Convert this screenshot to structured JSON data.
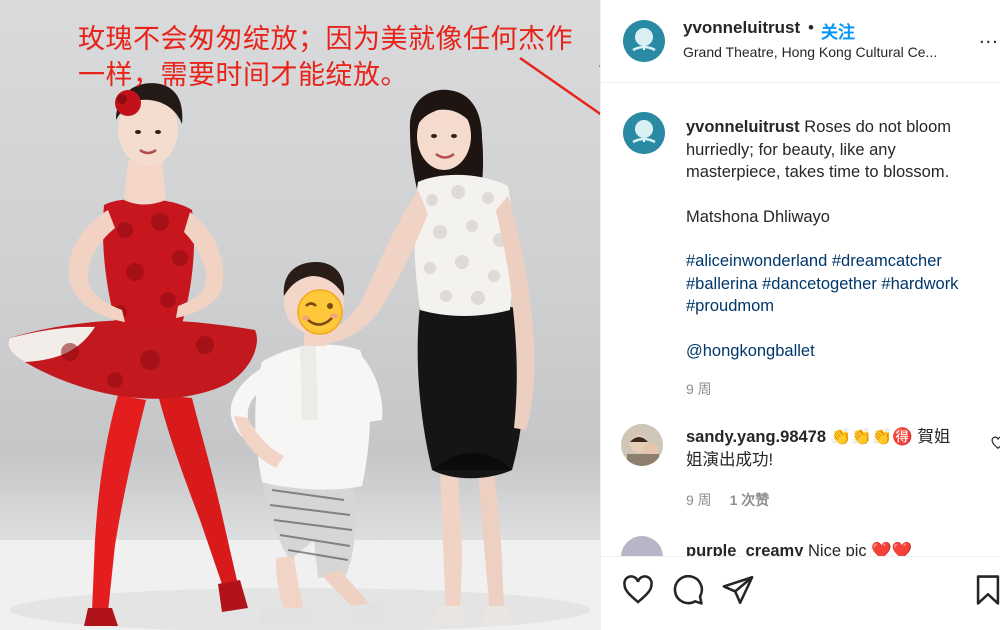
{
  "photo": {
    "overlay_caption": "玫瑰不会匆匆绽放；因为美就像任何杰作一样，需要时间才能绽放。"
  },
  "header": {
    "username": "yvonneluitrust",
    "separator": "•",
    "follow_label": "关注",
    "location": "Grand Theatre, Hong Kong Cultural Ce...",
    "more_label": "..."
  },
  "caption": {
    "username": "yvonneluitrust",
    "text": "Roses do not bloom hurriedly; for beauty, like any masterpiece, takes time to blossom.",
    "attribution": "Matshona Dhliwayo",
    "hashtags_line1": "#aliceinwonderland #dreamcatcher",
    "hashtags_line2": "#ballerina #dancetogether #hardwork",
    "hashtags_line3": "#proudmom",
    "mention": "@hongkongballet",
    "time": "9 周"
  },
  "comments": [
    {
      "username": "sandy.yang.98478",
      "emoji": "👏👏👏🉐",
      "text_line1": "賀姐",
      "text_line2": "姐演出成功!",
      "time": "9 周",
      "likes": "1 次赞"
    },
    {
      "username": "purple_creamy",
      "text": "Nice pic",
      "emoji": "❤️❤️"
    }
  ],
  "icons": {
    "like": "heart-icon",
    "comment": "comment-icon",
    "share": "share-icon",
    "save": "bookmark-icon",
    "comment_like": "small-heart-icon"
  },
  "colors": {
    "accent": "#0095f6",
    "caption_red": "#e8231a",
    "tag": "#00376b",
    "muted": "#8e8e8e"
  }
}
